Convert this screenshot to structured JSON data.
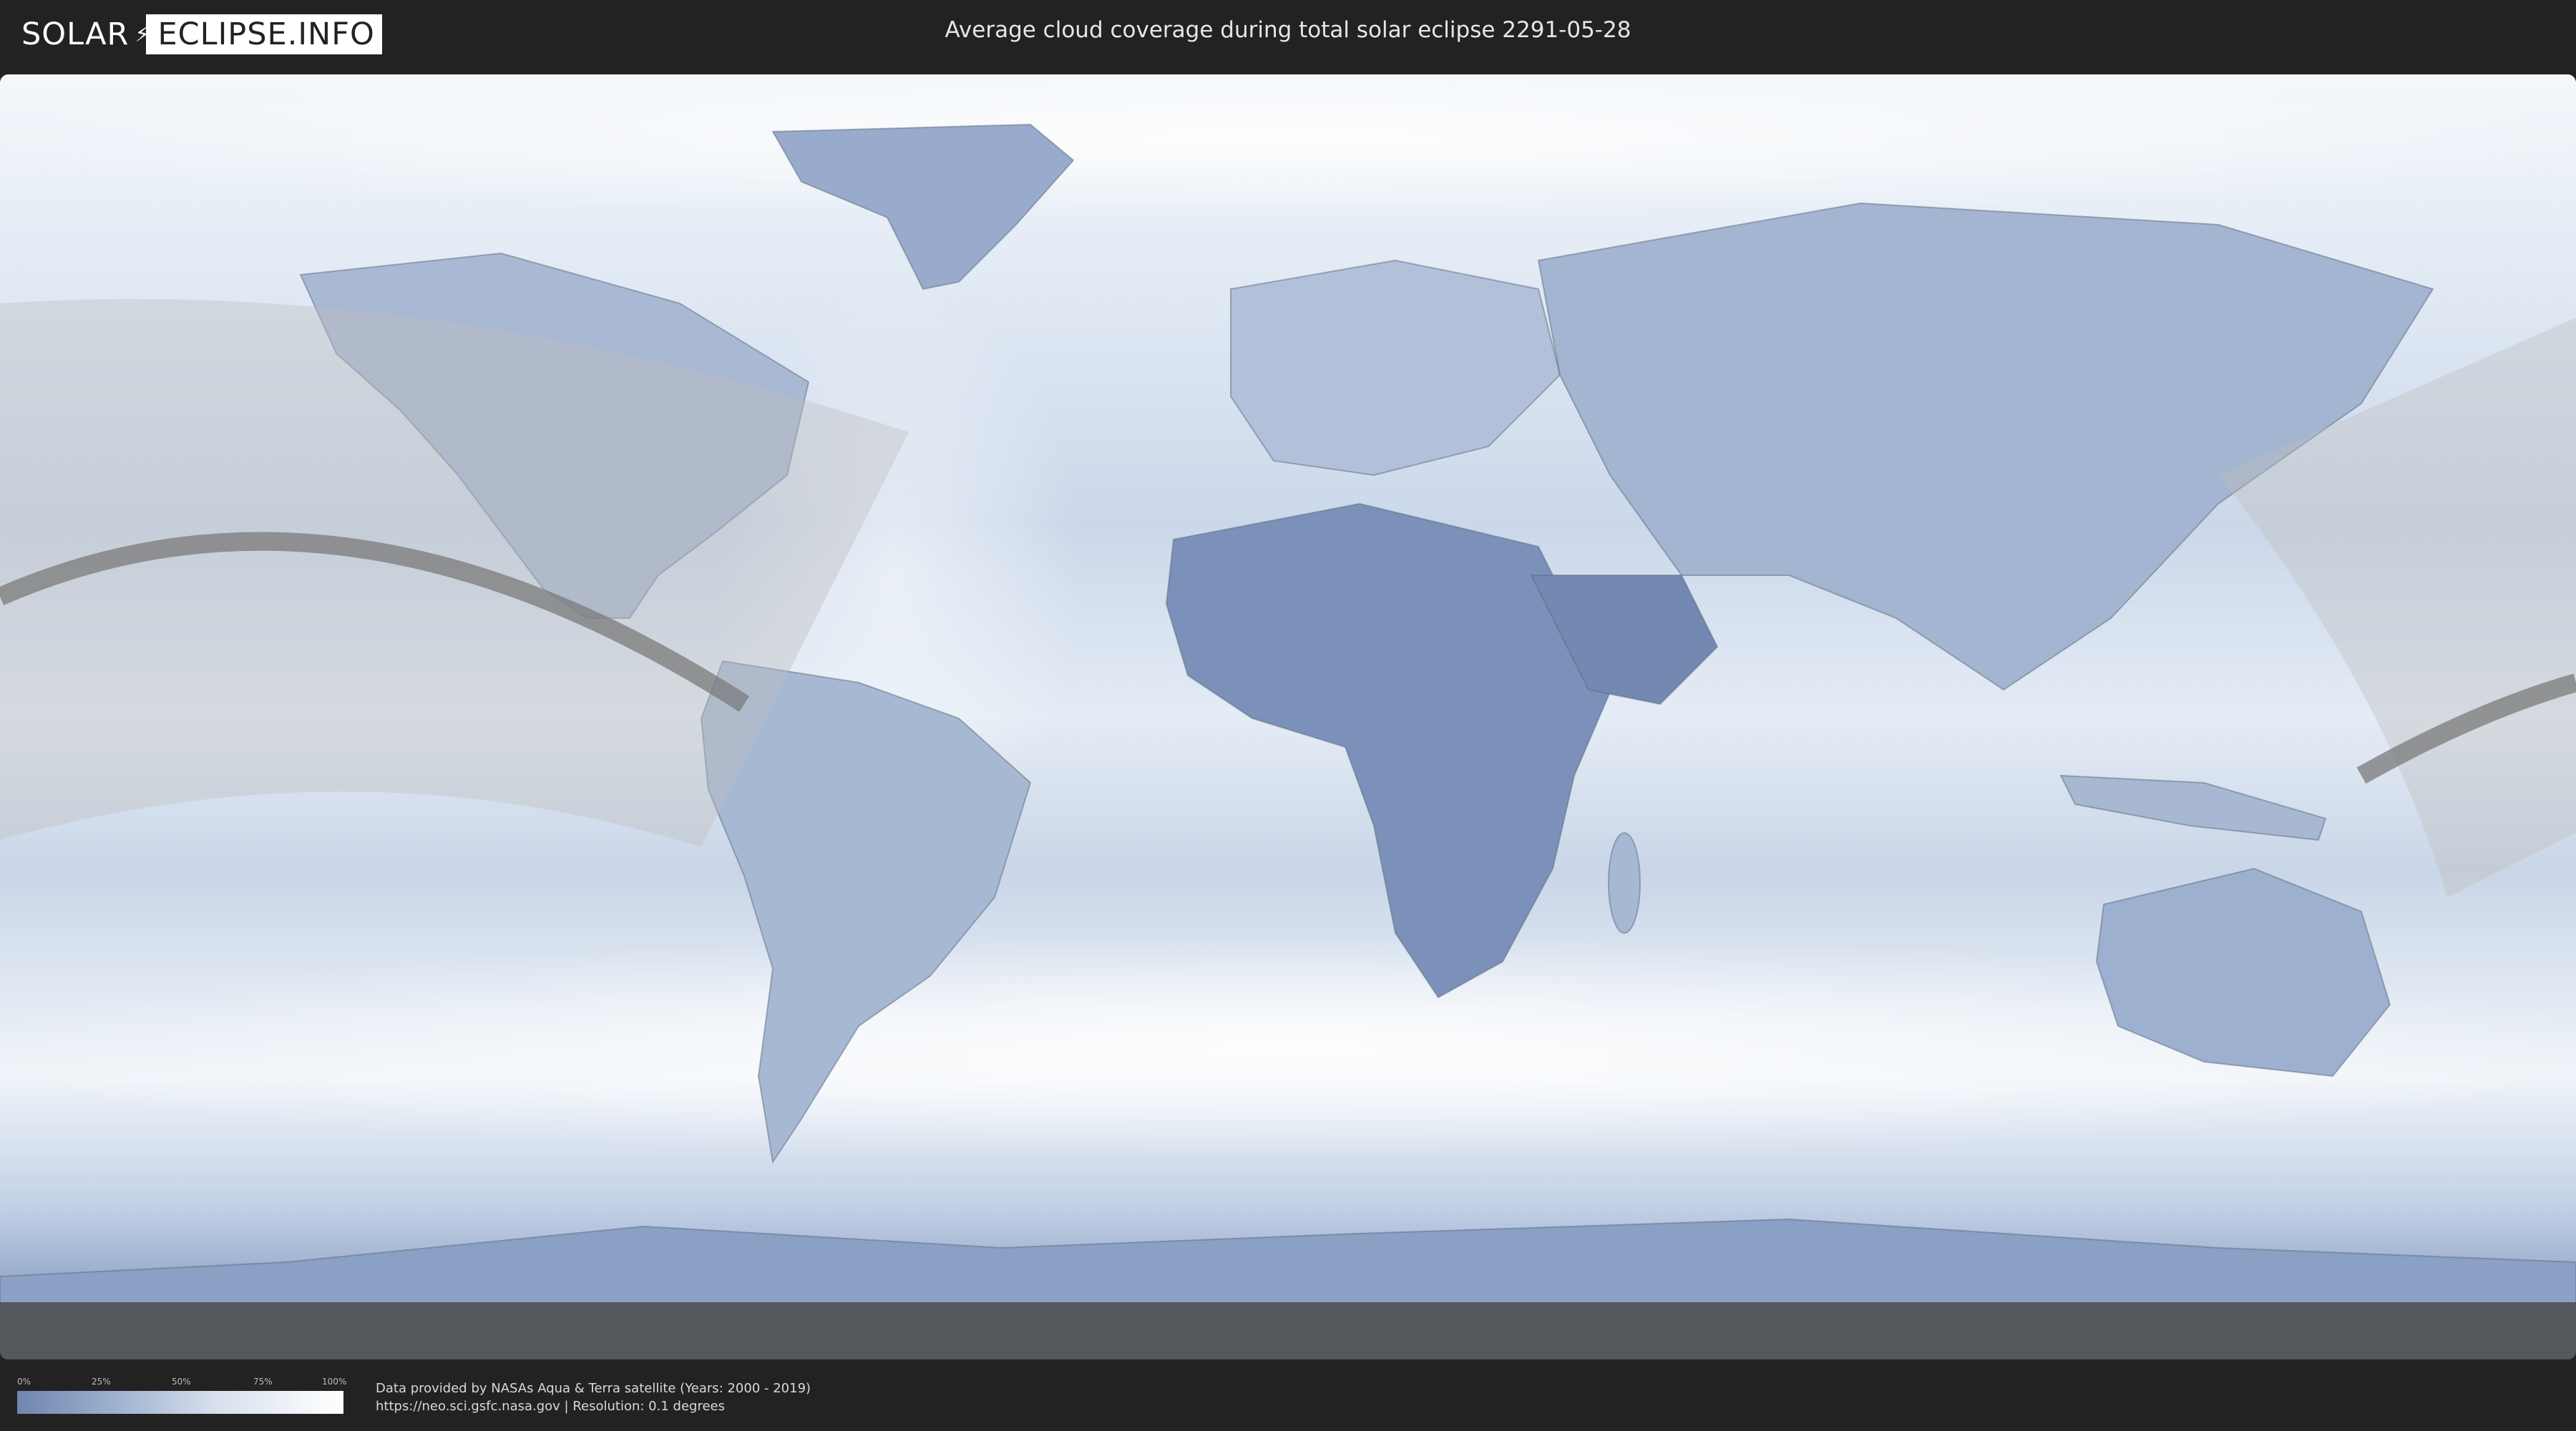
{
  "header": {
    "logo_left": "SOLAR",
    "logo_right": "ECLIPSE.INFO",
    "title": "Average cloud coverage during total solar eclipse 2291-05-28"
  },
  "legend": {
    "ticks": [
      "0%",
      "25%",
      "50%",
      "75%",
      "100%"
    ],
    "gradient_colors": [
      "#6f86ad",
      "#9eb1cf",
      "#d6dfec",
      "#ffffff"
    ]
  },
  "credits": {
    "line1": "Data provided by NASAs Aqua & Terra satellite (Years: 2000 - 2019)",
    "line2": "https://neo.sci.gsfc.nasa.gov | Resolution: 0.1 degrees"
  },
  "colors": {
    "background": "#222222",
    "cloud_low": "#6f86ad",
    "cloud_high": "#ffffff",
    "eclipse_shadow": "#bdbdbd",
    "totality_path": "#7a7a7a"
  }
}
